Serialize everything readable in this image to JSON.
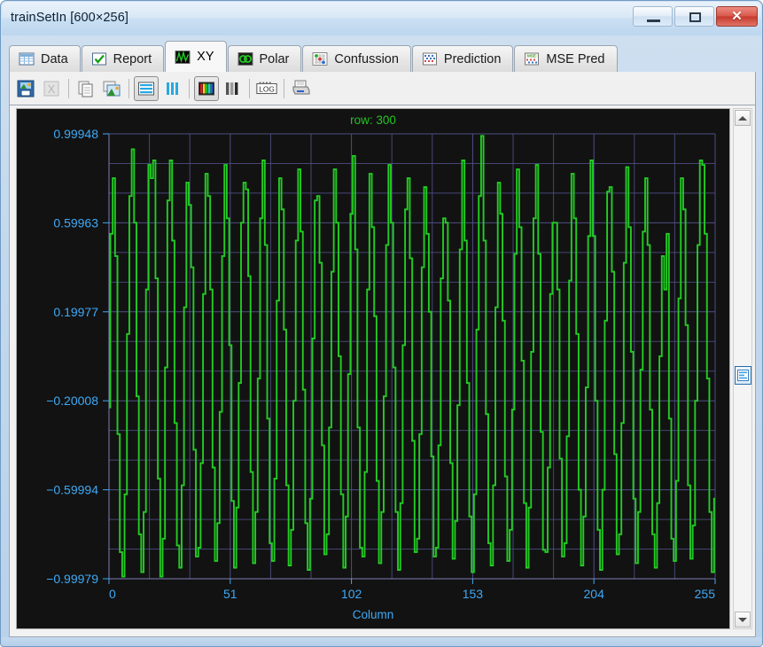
{
  "window": {
    "title": "trainSetIn [600×256]",
    "controls": {
      "minimize": "Minimize",
      "maximize": "Maximize",
      "close": "✕"
    }
  },
  "tabs": [
    {
      "label": "Data",
      "icon": "table-grid-icon",
      "active": false
    },
    {
      "label": "Report",
      "icon": "checkmark-icon",
      "active": false
    },
    {
      "label": "XY",
      "icon": "waveform-icon",
      "active": true
    },
    {
      "label": "Polar",
      "icon": "polar-circles-icon",
      "active": false
    },
    {
      "label": "Confussion",
      "icon": "confusion-dots-icon",
      "active": false
    },
    {
      "label": "Prediction",
      "icon": "prediction-grid-icon",
      "active": false
    },
    {
      "label": "MSE Pred",
      "icon": "mse-grid-icon",
      "active": false
    }
  ],
  "toolbar": [
    {
      "name": "save-image-button",
      "icon": "save-image-icon",
      "pressed": false,
      "enabled": true
    },
    {
      "name": "export-excel-button",
      "icon": "excel-icon",
      "pressed": false,
      "enabled": false
    },
    {
      "name": "copy-button",
      "icon": "copy-pages-icon",
      "pressed": false,
      "enabled": true
    },
    {
      "name": "copy-image-button",
      "icon": "copy-image-icon",
      "pressed": false,
      "enabled": true
    },
    {
      "name": "horizontal-lines-button",
      "icon": "horizontal-lines-icon",
      "pressed": true,
      "enabled": true
    },
    {
      "name": "vertical-lines-button",
      "icon": "vertical-lines-icon",
      "pressed": false,
      "enabled": true
    },
    {
      "name": "color-bars-button",
      "icon": "color-bars-icon",
      "pressed": true,
      "enabled": true
    },
    {
      "name": "gray-bars-button",
      "icon": "gray-bars-icon",
      "pressed": false,
      "enabled": true
    },
    {
      "name": "log-scale-button",
      "icon": "log-icon",
      "pressed": false,
      "enabled": true
    },
    {
      "name": "print-button",
      "icon": "printer-icon",
      "pressed": false,
      "enabled": true
    }
  ],
  "colors": {
    "plot_background": "#121212",
    "grid": "#4f4f87",
    "series": "#22cc22",
    "axis_text": "#3fa9f5",
    "title_text": "#25c425"
  },
  "chart_data": {
    "type": "line",
    "title": "row: 300",
    "xlabel": "Column",
    "ylabel": "",
    "grid": true,
    "legend": "none",
    "xlim": [
      0,
      255
    ],
    "ylim": [
      -0.99979,
      0.99948
    ],
    "xticks": [
      0,
      51,
      102,
      153,
      204,
      255
    ],
    "xticklabels": [
      "0",
      "51",
      "102",
      "153",
      "204",
      "255"
    ],
    "yticks": [
      0.99948,
      0.59963,
      0.19977,
      -0.20008,
      -0.59994,
      -0.99979
    ],
    "yticklabels": [
      "0.99948",
      "0.59963",
      "0.19977",
      "−0.20008",
      "−0.59994",
      "−0.99979"
    ],
    "series_name": "row 300",
    "x": [
      0,
      1,
      2,
      3,
      4,
      5,
      6,
      7,
      8,
      9,
      10,
      11,
      12,
      13,
      14,
      15,
      16,
      17,
      18,
      19,
      20,
      21,
      22,
      23,
      24,
      25,
      26,
      27,
      28,
      29,
      30,
      31,
      32,
      33,
      34,
      35,
      36,
      37,
      38,
      39,
      40,
      41,
      42,
      43,
      44,
      45,
      46,
      47,
      48,
      49,
      50,
      51,
      52,
      53,
      54,
      55,
      56,
      57,
      58,
      59,
      60,
      61,
      62,
      63,
      64,
      65,
      66,
      67,
      68,
      69,
      70,
      71,
      72,
      73,
      74,
      75,
      76,
      77,
      78,
      79,
      80,
      81,
      82,
      83,
      84,
      85,
      86,
      87,
      88,
      89,
      90,
      91,
      92,
      93,
      94,
      95,
      96,
      97,
      98,
      99,
      100,
      101,
      102,
      103,
      104,
      105,
      106,
      107,
      108,
      109,
      110,
      111,
      112,
      113,
      114,
      115,
      116,
      117,
      118,
      119,
      120,
      121,
      122,
      123,
      124,
      125,
      126,
      127,
      128,
      129,
      130,
      131,
      132,
      133,
      134,
      135,
      136,
      137,
      138,
      139,
      140,
      141,
      142,
      143,
      144,
      145,
      146,
      147,
      148,
      149,
      150,
      151,
      152,
      153,
      154,
      155,
      156,
      157,
      158,
      159,
      160,
      161,
      162,
      163,
      164,
      165,
      166,
      167,
      168,
      169,
      170,
      171,
      172,
      173,
      174,
      175,
      176,
      177,
      178,
      179,
      180,
      181,
      182,
      183,
      184,
      185,
      186,
      187,
      188,
      189,
      190,
      191,
      192,
      193,
      194,
      195,
      196,
      197,
      198,
      199,
      200,
      201,
      202,
      203,
      204,
      205,
      206,
      207,
      208,
      209,
      210,
      211,
      212,
      213,
      214,
      215,
      216,
      217,
      218,
      219,
      220,
      221,
      222,
      223,
      224,
      225,
      226,
      227,
      228,
      229,
      230,
      231,
      232,
      233,
      234,
      235,
      236,
      237,
      238,
      239,
      240,
      241,
      242,
      243,
      244,
      245,
      246,
      247,
      248,
      249,
      250,
      251,
      252,
      253,
      254,
      255
    ],
    "y": [
      -0.23,
      0.55,
      0.8,
      0.45,
      -0.35,
      -0.88,
      -0.99,
      -0.62,
      0.1,
      0.72,
      0.93,
      0.6,
      -0.18,
      -0.8,
      -0.97,
      -0.7,
      0.3,
      0.86,
      0.8,
      0.88,
      0.35,
      -0.55,
      -0.99,
      -0.82,
      -0.05,
      0.7,
      0.88,
      0.52,
      -0.3,
      -0.85,
      -0.95,
      -0.58,
      0.22,
      0.78,
      0.68,
      0.4,
      -0.42,
      -0.9,
      -0.86,
      -0.48,
      0.28,
      0.82,
      0.72,
      0.3,
      -0.5,
      -0.92,
      -0.75,
      -0.25,
      0.45,
      0.86,
      0.62,
      0.05,
      -0.65,
      -0.95,
      -0.68,
      -0.12,
      0.6,
      0.78,
      0.75,
      0.36,
      -0.52,
      -0.93,
      -0.7,
      -0.1,
      0.62,
      0.88,
      0.5,
      -0.28,
      -0.84,
      -0.92,
      -0.55,
      0.25,
      0.8,
      0.66,
      0.12,
      -0.58,
      -0.94,
      -0.78,
      -0.2,
      0.52,
      0.84,
      0.56,
      -0.15,
      -0.75,
      -0.96,
      -0.64,
      0.08,
      0.7,
      0.72,
      0.42,
      -0.4,
      -0.89,
      -0.8,
      -0.32,
      0.38,
      0.84,
      0.6,
      0.0,
      -0.62,
      -0.95,
      -0.72,
      -0.08,
      0.64,
      0.9,
      0.48,
      -0.32,
      -0.86,
      -0.9,
      -0.52,
      0.3,
      0.82,
      0.58,
      0.18,
      -0.56,
      -0.93,
      -0.7,
      -0.18,
      0.5,
      0.86,
      0.6,
      -0.05,
      -0.7,
      -0.96,
      -0.66,
      0.05,
      0.66,
      0.8,
      0.44,
      -0.38,
      -0.88,
      -0.82,
      -0.35,
      0.4,
      0.76,
      0.55,
      0.2,
      -0.45,
      -0.9,
      -0.86,
      -0.4,
      0.35,
      0.62,
      0.6,
      0.25,
      -0.48,
      -0.91,
      -0.74,
      -0.22,
      0.48,
      0.88,
      0.52,
      -0.12,
      -0.72,
      -0.97,
      -0.62,
      0.12,
      0.72,
      0.99,
      0.52,
      -0.26,
      -0.84,
      -0.94,
      -0.58,
      0.22,
      0.78,
      0.64,
      0.16,
      -0.54,
      -0.92,
      -0.78,
      -0.24,
      0.46,
      0.84,
      0.58,
      -0.02,
      -0.66,
      -0.95,
      -0.68,
      0.02,
      0.62,
      0.86,
      0.46,
      -0.34,
      -0.87,
      -0.88,
      -0.5,
      0.28,
      0.6,
      0.6,
      0.3,
      -0.46,
      -0.9,
      -0.84,
      -0.36,
      0.34,
      0.82,
      0.62,
      0.1,
      -0.6,
      -0.94,
      -0.72,
      -0.14,
      0.54,
      0.88,
      0.54,
      -0.2,
      -0.78,
      -0.96,
      -0.6,
      0.16,
      0.74,
      0.76,
      0.38,
      -0.44,
      -0.89,
      -0.8,
      -0.3,
      0.42,
      0.85,
      0.58,
      0.02,
      -0.64,
      -0.93,
      -0.7,
      -0.06,
      0.56,
      0.8,
      0.5,
      -0.24,
      -0.8,
      -0.95,
      -0.66,
      0.0,
      0.45,
      0.3,
      0.55,
      -0.28,
      -0.82,
      -0.92,
      -0.56,
      0.26,
      0.8,
      0.66,
      0.14,
      -0.58,
      -0.91,
      -0.76,
      -0.2,
      0.5,
      0.88,
      0.86,
      0.55,
      -0.1,
      -0.7,
      -0.97,
      -0.64,
      0.22
    ]
  }
}
